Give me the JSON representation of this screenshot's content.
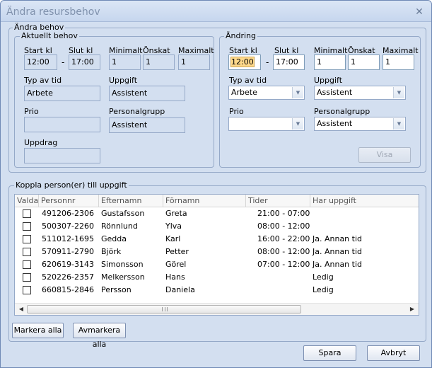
{
  "window": {
    "title": "Ändra resursbehov",
    "close_glyph": "✕"
  },
  "change_group": {
    "legend": "Ändra behov"
  },
  "current": {
    "legend": "Aktuellt behov",
    "start_label": "Start kl",
    "start_value": "12:00",
    "end_label": "Slut kl",
    "end_value": "17:00",
    "min_label": "Minimalt",
    "min_value": "1",
    "wish_label": "Önskat",
    "wish_value": "1",
    "max_label": "Maximalt",
    "max_value": "1",
    "type_label": "Typ av tid",
    "type_value": "Arbete",
    "task_label": "Uppgift",
    "task_value": "Assistent",
    "prio_label": "Prio",
    "prio_value": "",
    "staffgroup_label": "Personalgrupp",
    "staffgroup_value": "Assistent",
    "assignment_label": "Uppdrag",
    "assignment_value": ""
  },
  "change": {
    "legend": "Ändring",
    "start_label": "Start kl",
    "start_value": "12:00",
    "end_label": "Slut kl",
    "end_value": "17:00",
    "min_label": "Minimalt",
    "min_value": "1",
    "wish_label": "Önskat",
    "wish_value": "1",
    "max_label": "Maximalt",
    "max_value": "1",
    "type_label": "Typ av tid",
    "type_value": "Arbete",
    "task_label": "Uppgift",
    "task_value": "Assistent",
    "prio_label": "Prio",
    "prio_value": "",
    "staffgroup_label": "Personalgrupp",
    "staffgroup_value": "Assistent",
    "show_button": "Visa"
  },
  "connect": {
    "legend": "Koppla person(er) till uppgift",
    "columns": [
      "Valda",
      "Personnr",
      "Efternamn",
      "Förnamn",
      "Tider",
      "Har uppgift"
    ],
    "rows": [
      {
        "personnr": "491206-2306",
        "last": "Gustafsson",
        "first": "Greta",
        "time": "21:00 - 07:00",
        "task": ""
      },
      {
        "personnr": "500307-2260",
        "last": "Rönnlund",
        "first": "Ylva",
        "time": "08:00 - 12:00",
        "task": ""
      },
      {
        "personnr": "511012-1695",
        "last": "Gedda",
        "first": "Karl",
        "time": "16:00 - 22:00",
        "task": "Ja. Annan tid"
      },
      {
        "personnr": "570911-2790",
        "last": "Björk",
        "first": "Petter",
        "time": "08:00 - 12:00",
        "task": "Ja. Annan tid"
      },
      {
        "personnr": "620619-3143",
        "last": "Simonsson",
        "first": "Görel",
        "time": "07:00 - 12:00",
        "task": "Ja. Annan tid"
      },
      {
        "personnr": "520226-2357",
        "last": "Melkersson",
        "first": "Hans",
        "time": "",
        "task": "Ledig"
      },
      {
        "personnr": "660815-2846",
        "last": "Persson",
        "first": "Daniela",
        "time": "",
        "task": "Ledig"
      }
    ]
  },
  "buttons": {
    "mark_all": "Markera alla",
    "unmark_all": "Avmarkera alla",
    "save": "Spara",
    "cancel": "Avbryt"
  },
  "icons": {
    "scroll_left": "◀",
    "scroll_right": "▶",
    "dropdown": "▼"
  }
}
